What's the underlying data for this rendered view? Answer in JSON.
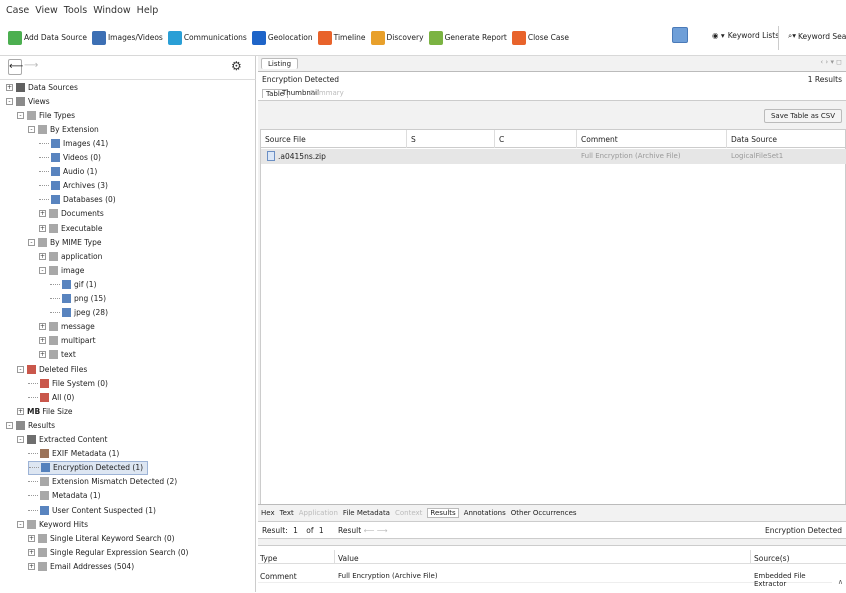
{
  "menu": [
    "Case",
    "View",
    "Tools",
    "Window",
    "Help"
  ],
  "toolbar": {
    "left": [
      {
        "label": "Add Data Source",
        "icon": "add-data-source-icon",
        "color": "#4caf50"
      },
      {
        "label": "Images/Videos",
        "icon": "images-videos-icon",
        "color": "#3c6fb4"
      },
      {
        "label": "Communications",
        "icon": "communications-icon",
        "color": "#2a9fd6"
      },
      {
        "label": "Geolocation",
        "icon": "geolocation-icon",
        "color": "#1e64c8"
      },
      {
        "label": "Timeline",
        "icon": "timeline-icon",
        "color": "#e8632b"
      },
      {
        "label": "Discovery",
        "icon": "discovery-icon",
        "color": "#e8a02b"
      },
      {
        "label": "Generate Report",
        "icon": "generate-report-icon",
        "color": "#7bb342"
      },
      {
        "label": "Close Case",
        "icon": "close-case-icon",
        "color": "#e8632b"
      }
    ],
    "keyword_lists": "Keyword Lists",
    "keyword_search": "Keyword Search"
  },
  "tree": [
    {
      "label": "Data Sources",
      "level": 0,
      "exp": "+",
      "icon": "data-sources-icon",
      "color": "#444"
    },
    {
      "label": "Views",
      "level": 0,
      "exp": "-",
      "icon": "views-icon",
      "color": "#777"
    },
    {
      "label": "File Types",
      "level": 1,
      "exp": "-",
      "icon": "file-types-icon",
      "color": "#999"
    },
    {
      "label": "By Extension",
      "level": 2,
      "exp": "-",
      "icon": "folder-icon",
      "color": "#999"
    },
    {
      "label": "Images (41)",
      "level": 3,
      "exp": "",
      "icon": "file-icon",
      "color": "#3c6fb4"
    },
    {
      "label": "Videos (0)",
      "level": 3,
      "exp": "",
      "icon": "file-icon",
      "color": "#3c6fb4"
    },
    {
      "label": "Audio (1)",
      "level": 3,
      "exp": "",
      "icon": "file-icon",
      "color": "#3c6fb4"
    },
    {
      "label": "Archives (3)",
      "level": 3,
      "exp": "",
      "icon": "file-icon",
      "color": "#3c6fb4"
    },
    {
      "label": "Databases (0)",
      "level": 3,
      "exp": "",
      "icon": "file-icon",
      "color": "#3c6fb4"
    },
    {
      "label": "Documents",
      "level": 3,
      "exp": "+",
      "icon": "folder-icon",
      "color": "#999"
    },
    {
      "label": "Executable",
      "level": 3,
      "exp": "+",
      "icon": "folder-icon",
      "color": "#999"
    },
    {
      "label": "By MIME Type",
      "level": 2,
      "exp": "-",
      "icon": "folder-icon",
      "color": "#999"
    },
    {
      "label": "application",
      "level": 3,
      "exp": "+",
      "icon": "folder-icon",
      "color": "#999"
    },
    {
      "label": "image",
      "level": 3,
      "exp": "-",
      "icon": "folder-icon",
      "color": "#999"
    },
    {
      "label": "gif (1)",
      "level": 4,
      "exp": "",
      "icon": "file-icon",
      "color": "#3c6fb4"
    },
    {
      "label": "png (15)",
      "level": 4,
      "exp": "",
      "icon": "file-icon",
      "color": "#3c6fb4"
    },
    {
      "label": "jpeg (28)",
      "level": 4,
      "exp": "",
      "icon": "file-icon",
      "color": "#3c6fb4"
    },
    {
      "label": "message",
      "level": 3,
      "exp": "+",
      "icon": "folder-icon",
      "color": "#999"
    },
    {
      "label": "multipart",
      "level": 3,
      "exp": "+",
      "icon": "folder-icon",
      "color": "#999"
    },
    {
      "label": "text",
      "level": 3,
      "exp": "+",
      "icon": "folder-icon",
      "color": "#999"
    },
    {
      "label": "Deleted Files",
      "level": 1,
      "exp": "-",
      "icon": "deleted-icon",
      "color": "#c0392b"
    },
    {
      "label": "File System (0)",
      "level": 2,
      "exp": "",
      "icon": "deleted-icon",
      "color": "#c0392b"
    },
    {
      "label": "All (0)",
      "level": 2,
      "exp": "",
      "icon": "deleted-icon",
      "color": "#c0392b"
    },
    {
      "label": "File Size",
      "level": 1,
      "exp": "+",
      "icon": "mb-icon",
      "color": "#333",
      "prefix": "MB"
    },
    {
      "label": "Results",
      "level": 0,
      "exp": "-",
      "icon": "results-icon",
      "color": "#777"
    },
    {
      "label": "Extracted Content",
      "level": 1,
      "exp": "-",
      "icon": "extracted-content-icon",
      "color": "#555"
    },
    {
      "label": "EXIF Metadata (1)",
      "level": 2,
      "exp": "",
      "icon": "exif-icon",
      "color": "#8a5a3c"
    },
    {
      "label": "Encryption Detected (1)",
      "level": 2,
      "exp": "",
      "icon": "encryption-icon",
      "color": "#3c6fb4",
      "selected": true
    },
    {
      "label": "Extension Mismatch Detected (2)",
      "level": 2,
      "exp": "",
      "icon": "mismatch-icon",
      "color": "#999"
    },
    {
      "label": "Metadata (1)",
      "level": 2,
      "exp": "",
      "icon": "metadata-icon",
      "color": "#999"
    },
    {
      "label": "User Content Suspected (1)",
      "level": 2,
      "exp": "",
      "icon": "user-content-icon",
      "color": "#3c6fb4"
    },
    {
      "label": "Keyword Hits",
      "level": 1,
      "exp": "-",
      "icon": "keyword-icon",
      "color": "#999"
    },
    {
      "label": "Single Literal Keyword Search (0)",
      "level": 2,
      "exp": "+",
      "icon": "keyword-icon",
      "color": "#999"
    },
    {
      "label": "Single Regular Expression Search (0)",
      "level": 2,
      "exp": "+",
      "icon": "keyword-icon",
      "color": "#999"
    },
    {
      "label": "Email Addresses (504)",
      "level": 2,
      "exp": "+",
      "icon": "keyword-icon",
      "color": "#999"
    }
  ],
  "listing": {
    "tab": "Listing",
    "heading": "Encryption Detected",
    "results": "1 Results",
    "view_tabs": [
      "Table",
      "Thumbnail",
      "Summary"
    ],
    "save_csv": "Save Table as CSV",
    "columns": [
      "Source File",
      "S",
      "C",
      "Comment",
      "Data Source"
    ],
    "rows": [
      {
        "file": ".a0415ns.zip",
        "s": "",
        "c": "",
        "comment": "Full Encryption (Archive File)",
        "source": "LogicalFileSet1"
      }
    ]
  },
  "content": {
    "tabs": [
      "Hex",
      "Text",
      "Application",
      "File Metadata",
      "Context",
      "Results",
      "Annotations",
      "Other Occurrences"
    ],
    "result_label": "Result:",
    "result_num": "1",
    "of": "of",
    "total": "1",
    "result_nav": "Result",
    "artifact_type": "Encryption Detected",
    "columns": [
      "Type",
      "Value",
      "Source(s)"
    ],
    "rows": [
      {
        "type": "Comment",
        "value": "Full Encryption (Archive File)",
        "source": "Embedded File Extractor"
      }
    ]
  }
}
